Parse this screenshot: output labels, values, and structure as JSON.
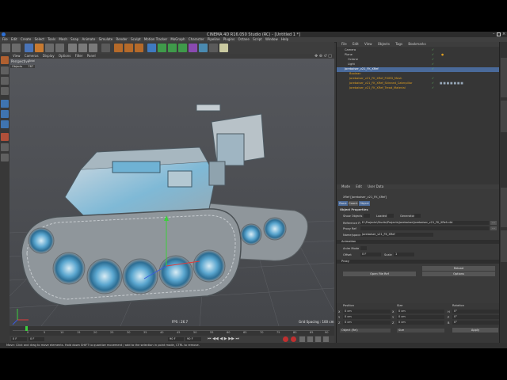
{
  "window": {
    "title": "CINEMA 4D R16.050 Studio (RC) - [Untitled 1 *]"
  },
  "menu": [
    "File",
    "Edit",
    "Create",
    "Select",
    "Tools",
    "Mesh",
    "Snap",
    "Animate",
    "Simulate",
    "Render",
    "Sculpt",
    "Motion Tracker",
    "MoGraph",
    "Character",
    "Pipeline",
    "Plugins",
    "Octane",
    "Script",
    "Window",
    "Help"
  ],
  "layout": {
    "label": "Layout:",
    "value": "Startup (User)"
  },
  "viewport": {
    "menu": [
      "View",
      "Cameras",
      "Display",
      "Options",
      "Filter",
      "Panel"
    ],
    "name": "Perspective",
    "hud_label": "Objects",
    "hud_value": "787",
    "hud_total_label": "Total",
    "fps": "FPS : 26.7",
    "grid": "Grid Spacing : 100 cm"
  },
  "timeline": {
    "ticks": [
      "0",
      "5",
      "10",
      "15",
      "20",
      "25",
      "30",
      "35",
      "40",
      "45",
      "50",
      "55",
      "60",
      "65",
      "70",
      "75",
      "80",
      "85",
      "90"
    ],
    "end": "0 F"
  },
  "transport": {
    "start": "0 F",
    "current": "0 F",
    "end": "90 F",
    "max": "90 F"
  },
  "status": "Move: Click and drag to move elements. Hold down SHIFT to quantize movement / add to the selection in point mode, CTRL to remove.",
  "object_manager": {
    "menu": [
      "File",
      "Edit",
      "View",
      "Objects",
      "Tags",
      "Bookmarks"
    ],
    "objects": [
      {
        "name": "Camera",
        "indent": 0,
        "color": "#cfcfcf"
      },
      {
        "name": "Plane",
        "indent": 0,
        "color": "#cfcfcf"
      },
      {
        "name": "Octane",
        "indent": 0,
        "color": "#cfcfcf"
      },
      {
        "name": "Light",
        "indent": 0,
        "color": "#cfcfcf"
      },
      {
        "name": "Jorebaiser_v21_FK_XRef",
        "indent": 0,
        "color": "#cfcfcf"
      },
      {
        "name": "Boolean",
        "indent": 1,
        "color": "#e0a020"
      },
      {
        "name": "Jorebaiser_v21_FK_XRef_FIXED_Mesh",
        "indent": 1,
        "color": "#e0a020"
      },
      {
        "name": "Jorebaiser_v21_FK_XRef_Skinned_Caterpillar",
        "indent": 1,
        "color": "#e0a020"
      },
      {
        "name": "Jorebaiser_v21_FK_XRef_Tread_Material",
        "indent": 1,
        "color": "#e0a020"
      }
    ]
  },
  "attribute_manager": {
    "menu": [
      "Mode",
      "Edit",
      "User Data"
    ],
    "object_title": "XRef [Jorebaiser_v21_FK_XRef]",
    "tabs": [
      "Basic",
      "Coord.",
      "Object"
    ],
    "section_object": "Object Properties",
    "show_objects_label": "Show Objects",
    "loaded_label": "Loaded",
    "generator_label": "Generator",
    "reference_label": "Reference File",
    "reference_value": "E:\\Projects\\Studio\\Projects\\Jorebaiser\\Jorebaiser_v21_FK_XRef.c4d",
    "proxy_label": "Proxy Ref",
    "name_label": "Name(space)",
    "name_value": "Jorebaiser_v21_FK_XRef",
    "section_animation": "Animation",
    "anim_label": "Anim Mode",
    "offset_label": "Offset",
    "offset_value": "0 F",
    "scale_label": "Scale",
    "scale_value": "1",
    "section_proxy": "Proxy",
    "btn_reload": "Reload",
    "btn_open": "Open File Ref",
    "btn_options": "Options"
  },
  "coordinates": {
    "headers": [
      "Position",
      "Size",
      "Rotation"
    ],
    "rows": [
      {
        "axis": "X",
        "pos": "0 cm",
        "size": "0 cm",
        "rot_label": "H",
        "rot": "0°"
      },
      {
        "axis": "Y",
        "pos": "0 cm",
        "size": "0 cm",
        "rot_label": "P",
        "rot": "0°"
      },
      {
        "axis": "Z",
        "pos": "0 cm",
        "size": "0 cm",
        "rot_label": "B",
        "rot": "0°"
      }
    ],
    "mode": "Object (Rel)",
    "size_mode": "Size",
    "apply": "Apply"
  },
  "colors": {
    "app_bg": "#3a3a3a",
    "viewport_bg": "#4a4c50",
    "accent_orange": "#e0a020",
    "selection": "#4a6a9a"
  }
}
